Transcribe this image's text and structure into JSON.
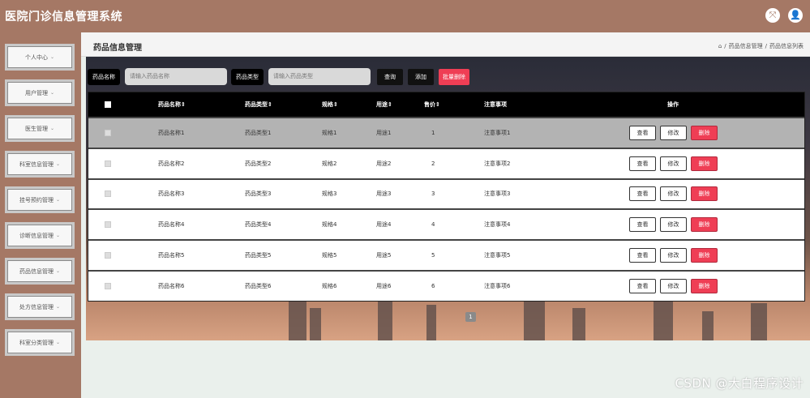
{
  "app": {
    "title": "医院门诊信息管理系统"
  },
  "top_icons": [
    "expand-icon",
    "user-icon"
  ],
  "sidebar": {
    "items": [
      {
        "label": "个人中心"
      },
      {
        "label": "用户管理"
      },
      {
        "label": "医生管理"
      },
      {
        "label": "科室信息管理"
      },
      {
        "label": "挂号预约管理"
      },
      {
        "label": "诊断信息管理"
      },
      {
        "label": "药品信息管理"
      },
      {
        "label": "处方信息管理"
      },
      {
        "label": "科室分类管理"
      }
    ]
  },
  "header": {
    "title": "药品信息管理",
    "breadcrumb": [
      "药品信息管理",
      "药品信息列表"
    ],
    "separator": "/"
  },
  "search": {
    "name_label": "药品名称",
    "name_placeholder": "请输入药品名称",
    "type_label": "药品类型",
    "type_placeholder": "请输入药品类型",
    "query_button": "查询",
    "add_button": "添加",
    "batch_delete_button": "批量删除"
  },
  "table": {
    "headers": [
      "药品名称⇕",
      "药品类型⇕",
      "规格⇕",
      "用途⇕",
      "售价⇕",
      "注意事项",
      "操作"
    ],
    "rows": [
      [
        "药品名称1",
        "药品类型1",
        "规格1",
        "用途1",
        "1",
        "注意事项1"
      ],
      [
        "药品名称2",
        "药品类型2",
        "规格2",
        "用途2",
        "2",
        "注意事项2"
      ],
      [
        "药品名称3",
        "药品类型3",
        "规格3",
        "用途3",
        "3",
        "注意事项3"
      ],
      [
        "药品名称4",
        "药品类型4",
        "规格4",
        "用途4",
        "4",
        "注意事项4"
      ],
      [
        "药品名称5",
        "药品类型5",
        "规格5",
        "用途5",
        "5",
        "注意事项5"
      ],
      [
        "药品名称6",
        "药品类型6",
        "规格6",
        "用途6",
        "6",
        "注意事项6"
      ]
    ],
    "actions": {
      "view": "查看",
      "edit": "修改",
      "delete": "删除"
    }
  },
  "pagination": {
    "current": "1"
  },
  "watermark": "CSDN @大白程序设计",
  "colors": {
    "brand": "#a57865",
    "danger": "#ef3e55",
    "header_bg": "#000000"
  }
}
